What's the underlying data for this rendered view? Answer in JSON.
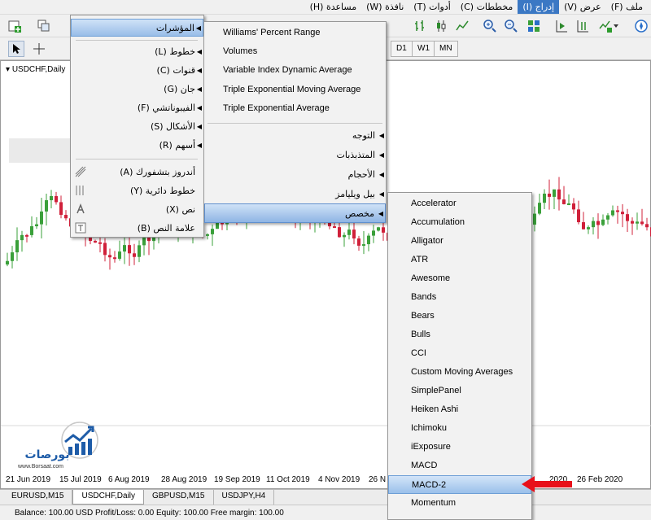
{
  "menubar": {
    "items": [
      {
        "label": "ملف (F)"
      },
      {
        "label": "عرض (V)"
      },
      {
        "label": "إدراج (I)"
      },
      {
        "label": "مخططات (C)"
      },
      {
        "label": "أدوات (T)"
      },
      {
        "label": "نافذة (W)"
      },
      {
        "label": "مساعدة (H)"
      }
    ]
  },
  "toolbar": {
    "timeframes": [
      "D1",
      "W1",
      "MN"
    ]
  },
  "insert_menu": {
    "items": [
      {
        "label": "المؤشرات",
        "has_submenu": true,
        "highlighted": true
      },
      {
        "label": "خطوط (L)",
        "has_submenu": true
      },
      {
        "label": "قنوات (C)",
        "has_submenu": true
      },
      {
        "label": "جان (G)",
        "has_submenu": true
      },
      {
        "label": "الفيبوناتشي (F)",
        "has_submenu": true
      },
      {
        "label": "الأشكال (S)",
        "has_submenu": true
      },
      {
        "label": "أسهم (R)",
        "has_submenu": true
      },
      {
        "label": "أندروز بتشفورك (A)",
        "icon": "pitchfork-icon"
      },
      {
        "label": "خطوط دائرية (Y)",
        "icon": "cycle-lines-icon"
      },
      {
        "label": "نص (X)",
        "icon": "text-icon"
      },
      {
        "label": "علامة النص (B)",
        "icon": "text-label-icon"
      }
    ]
  },
  "indicators_menu": {
    "items": [
      {
        "label": "Williams' Percent Range"
      },
      {
        "label": "Volumes"
      },
      {
        "label": "Variable Index Dynamic Average"
      },
      {
        "label": "Triple Exponential Moving Average"
      },
      {
        "label": "Triple Exponential Average"
      }
    ],
    "submenus": [
      {
        "label": "التوجه"
      },
      {
        "label": "المتذبذبات"
      },
      {
        "label": "الأحجام"
      },
      {
        "label": "بيل ويليامز"
      },
      {
        "label": "مخصص",
        "highlighted": true
      }
    ]
  },
  "custom_menu": {
    "items": [
      {
        "label": "Accelerator"
      },
      {
        "label": "Accumulation"
      },
      {
        "label": "Alligator"
      },
      {
        "label": "ATR"
      },
      {
        "label": "Awesome"
      },
      {
        "label": "Bands"
      },
      {
        "label": "Bears"
      },
      {
        "label": "Bulls"
      },
      {
        "label": "CCI"
      },
      {
        "label": "Custom Moving Averages"
      },
      {
        "label": "SimplePanel"
      },
      {
        "label": "Heiken Ashi"
      },
      {
        "label": "Ichimoku"
      },
      {
        "label": "iExposure"
      },
      {
        "label": "MACD"
      },
      {
        "label": "MACD-2",
        "highlighted": true
      },
      {
        "label": "Momentum"
      }
    ]
  },
  "chart": {
    "symbol_label": "USDCHF,Daily",
    "dates": [
      "21 Jun 2019",
      "15 Jul 2019",
      "6 Aug 2019",
      "28 Aug 2019",
      "19 Sep 2019",
      "11 Oct 2019",
      "4 Nov 2019",
      "26 N",
      "2020",
      "26 Feb 2020"
    ],
    "bull_color": "#3aa03a",
    "bear_color": "#d0203a"
  },
  "tabs": [
    {
      "label": "EURUSD,M15"
    },
    {
      "label": "USDCHF,Daily",
      "active": true
    },
    {
      "label": "GBPUSD,M15"
    },
    {
      "label": "USDJPY,H4"
    }
  ],
  "status": {
    "text": "Balance: 100.00 USD  Profit/Loss: 0.00  Equity: 100.00  Free margin: 100.00"
  },
  "logo": {
    "text": "بورصات",
    "url": "www.Borsaat.com"
  },
  "colors": {
    "menu_highlight": "#99bde8",
    "arrow_red": "#e8101a"
  }
}
